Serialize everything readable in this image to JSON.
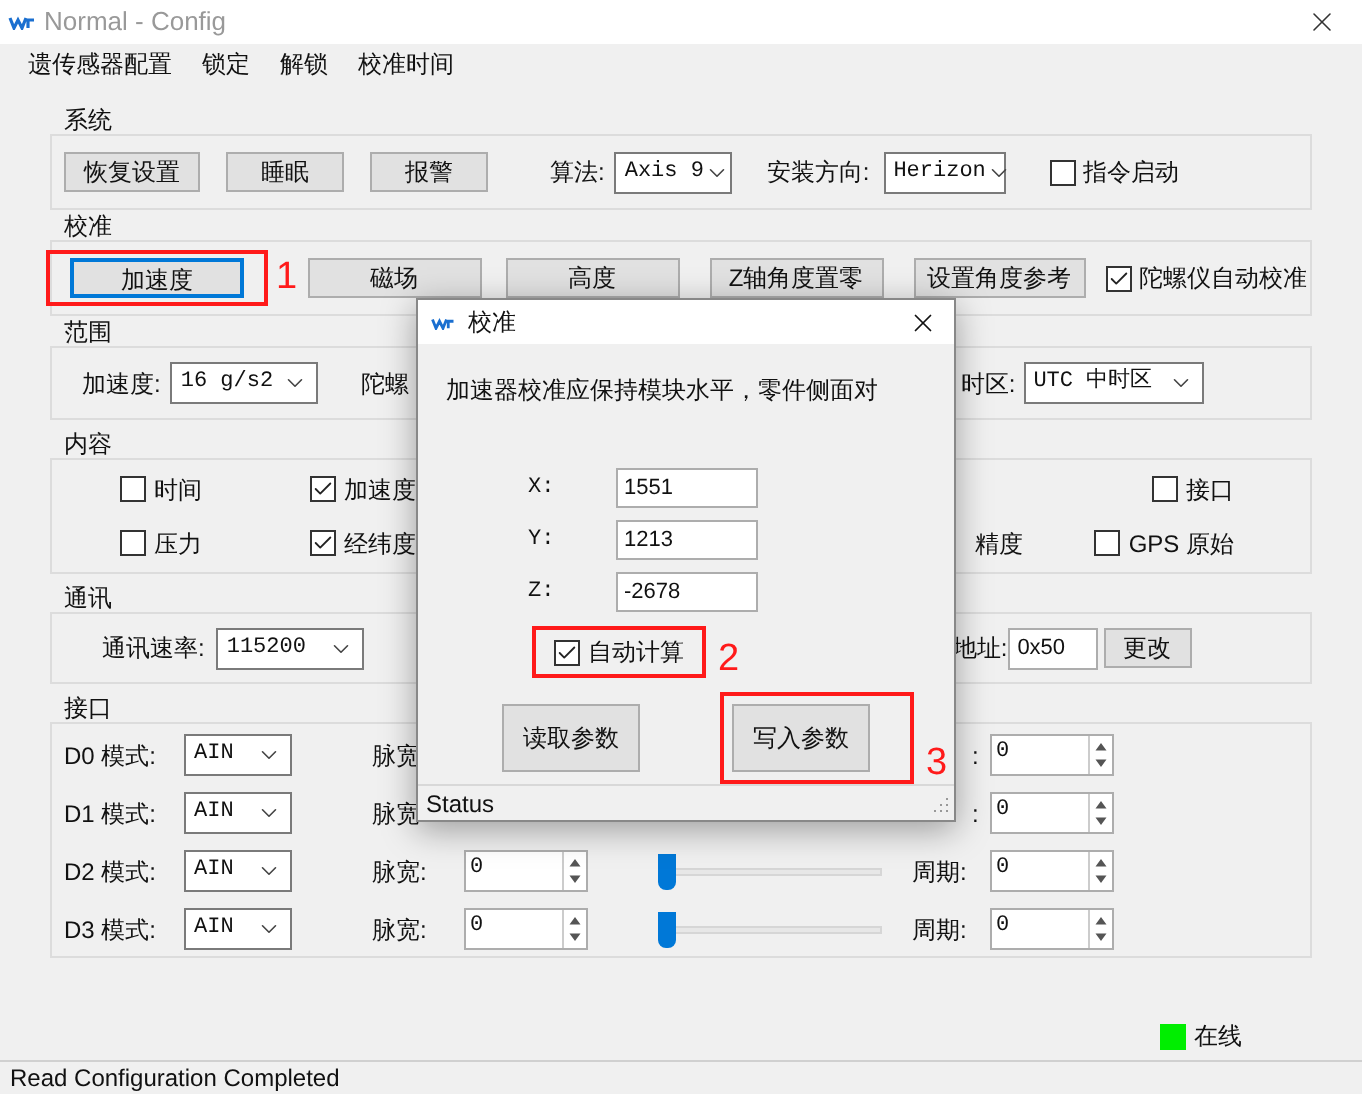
{
  "window": {
    "title": "Normal - Config"
  },
  "menu": [
    "遗传感器配置",
    "锁定",
    "解锁",
    "校准时间"
  ],
  "system": {
    "title": "系统",
    "buttons": [
      "恢复设置",
      "睡眠",
      "报警"
    ],
    "algorithm": {
      "label": "算法:",
      "value": "Axis 9"
    },
    "orientation": {
      "label": "安装方向:",
      "value": "Herizon"
    },
    "command_start": {
      "label": "指令启动",
      "checked": false
    }
  },
  "calibration": {
    "title": "校准",
    "buttons": [
      {
        "label": "加速度",
        "focused": true,
        "annotation": "1"
      },
      {
        "label": "磁场",
        "focused": false
      },
      {
        "label": "高度",
        "focused": false
      },
      {
        "label": "Z轴角度置零",
        "focused": false
      },
      {
        "label": "设置角度参考",
        "focused": false
      }
    ],
    "gyro_auto": {
      "label": "陀螺仪自动校准",
      "checked": true
    }
  },
  "range": {
    "title": "范围",
    "accel": {
      "label": "加速度:",
      "value": "16 g/s2"
    },
    "gyro_label": "陀螺",
    "timezone": {
      "label": "时区:",
      "value": "UTC  中时区"
    }
  },
  "content": {
    "title": "内容",
    "rows": [
      {
        "left": [
          {
            "kind": "checkbox",
            "label": "时间",
            "checked": false
          },
          {
            "kind": "checkbox",
            "label": "加速度",
            "checked": true
          }
        ],
        "right": [
          {
            "kind": "checkbox",
            "label": "接口",
            "checked": false
          }
        ]
      },
      {
        "left": [
          {
            "kind": "checkbox",
            "label": "压力",
            "checked": false
          },
          {
            "kind": "checkbox",
            "label": "经纬度",
            "checked": true
          }
        ],
        "right": [
          {
            "kind": "text",
            "label": "精度"
          },
          {
            "kind": "checkbox",
            "label": "GPS 原始",
            "checked": false
          }
        ]
      }
    ]
  },
  "comm": {
    "title": "通讯",
    "rate": {
      "label": "通讯速率:",
      "value": "115200"
    },
    "address": {
      "label": "地址:",
      "value": "0x50"
    },
    "change_button": "更改"
  },
  "ports": {
    "title": "接口",
    "rows": [
      {
        "name": "D0 模式:",
        "mode": "AIN",
        "pulse_label": "脉宽",
        "period_label": ":",
        "period": "0"
      },
      {
        "name": "D1 模式:",
        "mode": "AIN",
        "pulse_label": "脉宽",
        "period_label": ":",
        "period": "0"
      },
      {
        "name": "D2 模式:",
        "mode": "AIN",
        "pulse_label": "脉宽:",
        "pulse": "0",
        "level": 0,
        "period_label": "周期:",
        "period": "0"
      },
      {
        "name": "D3 模式:",
        "mode": "AIN",
        "pulse_label": "脉宽:",
        "pulse": "0",
        "level": 0,
        "period_label": "周期:",
        "period": "0"
      }
    ]
  },
  "connection": {
    "label": "在线",
    "online": true
  },
  "status_bar": "Read Configuration Completed",
  "dialog": {
    "title": "校准",
    "message": "加速器校准应保持模块水平，零件侧面对",
    "fields": [
      {
        "label": "X:",
        "value": "1551"
      },
      {
        "label": "Y:",
        "value": "1213"
      },
      {
        "label": "Z:",
        "value": "-2678"
      }
    ],
    "auto_calc": {
      "label": "自动计算",
      "checked": true,
      "annotation": "2"
    },
    "buttons": [
      {
        "label": "读取参数"
      },
      {
        "label": "写入参数",
        "annotation": "3"
      }
    ],
    "status": "Status"
  }
}
